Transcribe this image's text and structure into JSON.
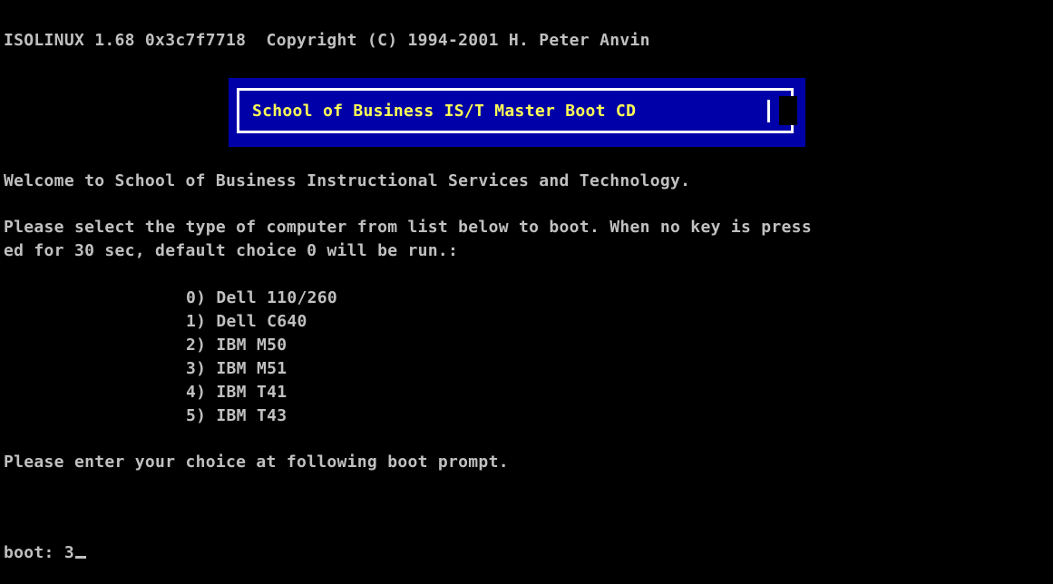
{
  "header": {
    "copyright_line": "ISOLINUX 1.68 0x3c7f7718  Copyright (C) 1994-2001 H. Peter Anvin"
  },
  "banner": {
    "title": "School of Business IS/T Master Boot CD"
  },
  "welcome": {
    "text": "Welcome to School of Business Instructional Services and Technology."
  },
  "instructions": {
    "line1": "Please select the type of computer from list below to boot. When no key is press",
    "line2": "ed for 30 sec, default choice 0 will be run.:"
  },
  "menu": {
    "items": [
      "0) Dell 110/260",
      "1) Dell C640",
      "2) IBM M50",
      "3) IBM M51",
      "4) IBM T41",
      "5) IBM T43"
    ]
  },
  "prompt_hint": {
    "text": "Please enter your choice at following boot prompt."
  },
  "boot_prompt": {
    "label": "boot:",
    "value": "3"
  },
  "colors": {
    "background": "#000000",
    "text": "#c0c0c0",
    "banner_background": "#0000a8",
    "banner_text": "#ffff55",
    "banner_border": "#ffffff"
  }
}
